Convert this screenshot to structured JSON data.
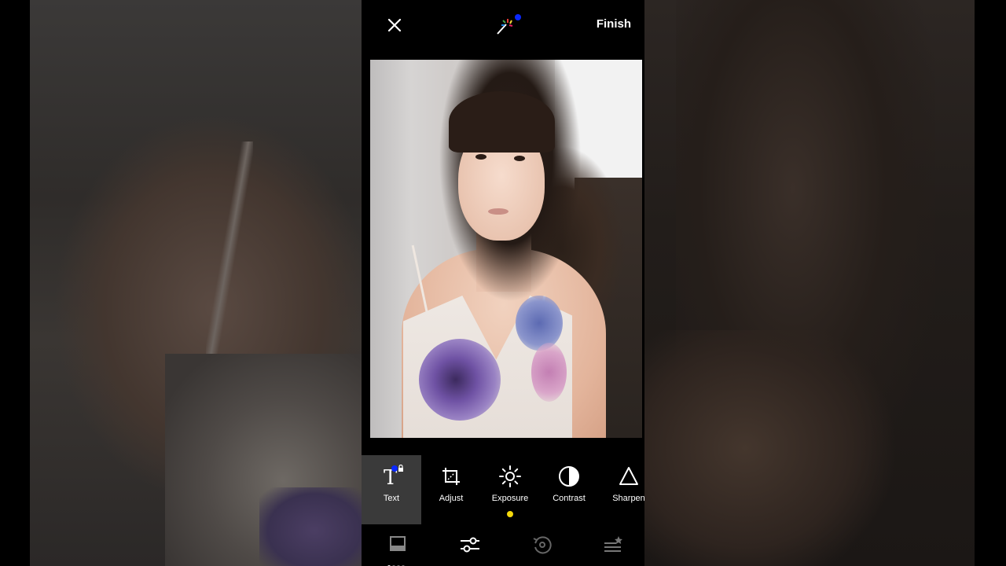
{
  "app": {
    "header": {
      "finish_label": "Finish",
      "close_icon": "close-icon",
      "magic_icon": "magic-wand-icon"
    },
    "tools": [
      {
        "label": "Text",
        "icon": "text-icon",
        "active": true,
        "locked": true,
        "badge_color": "#0a28ff"
      },
      {
        "label": "Adjust",
        "icon": "crop-icon",
        "active": false
      },
      {
        "label": "Exposure",
        "icon": "sun-icon",
        "active": false,
        "indicator_color": "#f6d90b"
      },
      {
        "label": "Contrast",
        "icon": "contrast-icon",
        "active": false
      },
      {
        "label": "Sharpen",
        "icon": "triangle-icon",
        "active": false
      }
    ],
    "bottom_nav": [
      {
        "icon": "looks-icon",
        "active": false
      },
      {
        "icon": "sliders-icon",
        "active": true
      },
      {
        "icon": "history-icon",
        "active": false
      },
      {
        "icon": "presets-icon",
        "active": false
      }
    ],
    "accent_blue": "#0a28ff"
  }
}
